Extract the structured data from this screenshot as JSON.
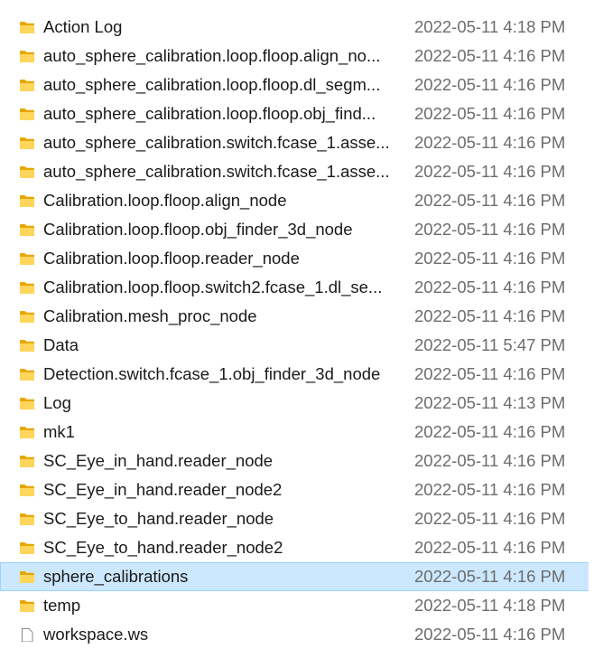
{
  "colors": {
    "folder_front": "#ffd65c",
    "folder_back": "#e8a700",
    "selected_bg": "#cce8ff",
    "selected_border": "#99d1ff",
    "date_text": "#6d6d6d"
  },
  "files": [
    {
      "name": "Action Log",
      "date": "2022-05-11 4:18 PM",
      "icon": "folder-icon"
    },
    {
      "name": "auto_sphere_calibration.loop.floop.align_no...",
      "date": "2022-05-11 4:16 PM",
      "icon": "folder-icon"
    },
    {
      "name": "auto_sphere_calibration.loop.floop.dl_segm...",
      "date": "2022-05-11 4:16 PM",
      "icon": "folder-icon"
    },
    {
      "name": "auto_sphere_calibration.loop.floop.obj_find...",
      "date": "2022-05-11 4:16 PM",
      "icon": "folder-icon"
    },
    {
      "name": "auto_sphere_calibration.switch.fcase_1.asse...",
      "date": "2022-05-11 4:16 PM",
      "icon": "folder-icon"
    },
    {
      "name": "auto_sphere_calibration.switch.fcase_1.asse...",
      "date": "2022-05-11 4:16 PM",
      "icon": "folder-icon"
    },
    {
      "name": "Calibration.loop.floop.align_node",
      "date": "2022-05-11 4:16 PM",
      "icon": "folder-icon"
    },
    {
      "name": "Calibration.loop.floop.obj_finder_3d_node",
      "date": "2022-05-11 4:16 PM",
      "icon": "folder-icon"
    },
    {
      "name": "Calibration.loop.floop.reader_node",
      "date": "2022-05-11 4:16 PM",
      "icon": "folder-icon"
    },
    {
      "name": "Calibration.loop.floop.switch2.fcase_1.dl_se...",
      "date": "2022-05-11 4:16 PM",
      "icon": "folder-icon"
    },
    {
      "name": "Calibration.mesh_proc_node",
      "date": "2022-05-11 4:16 PM",
      "icon": "folder-icon"
    },
    {
      "name": "Data",
      "date": "2022-05-11 5:47 PM",
      "icon": "folder-icon"
    },
    {
      "name": "Detection.switch.fcase_1.obj_finder_3d_node",
      "date": "2022-05-11 4:16 PM",
      "icon": "folder-icon"
    },
    {
      "name": "Log",
      "date": "2022-05-11 4:13 PM",
      "icon": "folder-icon"
    },
    {
      "name": "mk1",
      "date": "2022-05-11 4:16 PM",
      "icon": "folder-icon"
    },
    {
      "name": "SC_Eye_in_hand.reader_node",
      "date": "2022-05-11 4:16 PM",
      "icon": "folder-icon"
    },
    {
      "name": "SC_Eye_in_hand.reader_node2",
      "date": "2022-05-11 4:16 PM",
      "icon": "folder-icon"
    },
    {
      "name": "SC_Eye_to_hand.reader_node",
      "date": "2022-05-11 4:16 PM",
      "icon": "folder-icon"
    },
    {
      "name": "SC_Eye_to_hand.reader_node2",
      "date": "2022-05-11 4:16 PM",
      "icon": "folder-icon"
    },
    {
      "name": "sphere_calibrations",
      "date": "2022-05-11 4:16 PM",
      "icon": "folder-icon",
      "selected": true
    },
    {
      "name": "temp",
      "date": "2022-05-11 4:18 PM",
      "icon": "folder-icon"
    },
    {
      "name": "workspace.ws",
      "date": "2022-05-11 4:16 PM",
      "icon": "file-icon"
    }
  ]
}
